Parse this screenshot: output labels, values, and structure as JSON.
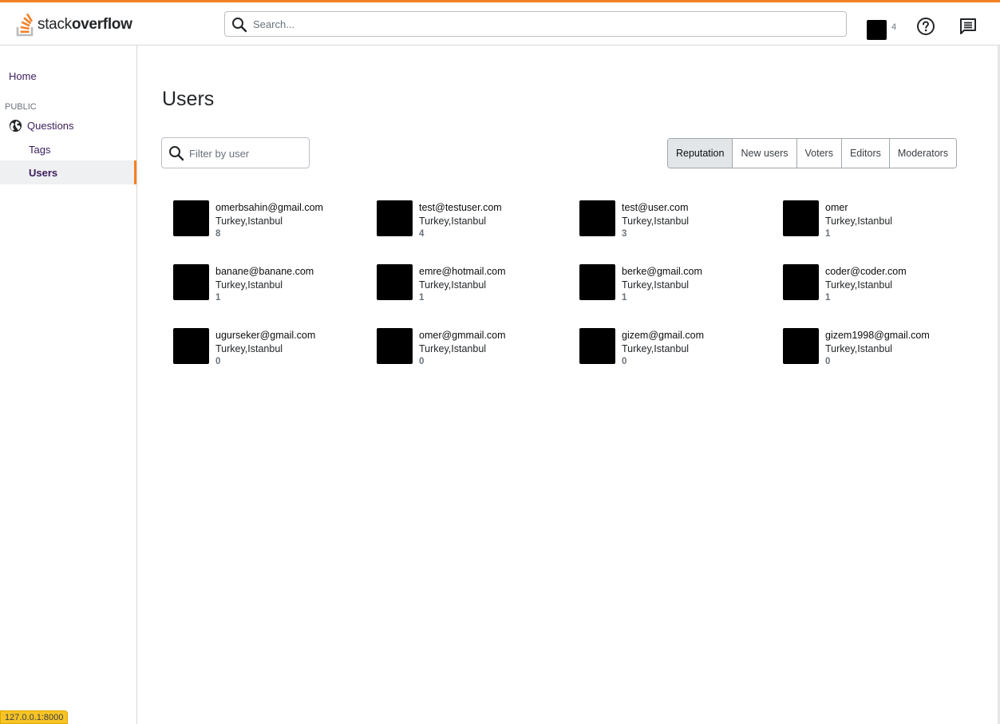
{
  "header": {
    "logo_light": "stack",
    "logo_bold": "overflow",
    "search_placeholder": "Search...",
    "reputation": "4",
    "icons": [
      "search-icon",
      "help-icon",
      "inbox-icon"
    ]
  },
  "sidebar": {
    "home": "Home",
    "section": "PUBLIC",
    "questions": "Questions",
    "tags": "Tags",
    "users": "Users",
    "icons": [
      "globe-icon"
    ]
  },
  "main": {
    "title": "Users",
    "filter_placeholder": "Filter by user",
    "tabs": [
      "Reputation",
      "New users",
      "Voters",
      "Editors",
      "Moderators"
    ],
    "active_tab": "Reputation",
    "users": [
      {
        "name": "omerbsahin@gmail.com",
        "location": "Turkey,Istanbul",
        "reputation": "8"
      },
      {
        "name": "test@testuser.com",
        "location": "Turkey,Istanbul",
        "reputation": "4"
      },
      {
        "name": "test@user.com",
        "location": "Turkey,Istanbul",
        "reputation": "3"
      },
      {
        "name": "omer",
        "location": "Turkey,Istanbul",
        "reputation": "1"
      },
      {
        "name": "banane@banane.com",
        "location": "Turkey,Istanbul",
        "reputation": "1"
      },
      {
        "name": "emre@hotmail.com",
        "location": "Turkey,Istanbul",
        "reputation": "1"
      },
      {
        "name": "berke@gmail.com",
        "location": "Turkey,Istanbul",
        "reputation": "1"
      },
      {
        "name": "coder@coder.com",
        "location": "Turkey,Istanbul",
        "reputation": "1"
      },
      {
        "name": "ugurseker@gmail.com",
        "location": "Turkey,Istanbul",
        "reputation": "0"
      },
      {
        "name": "omer@gmmail.com",
        "location": "Turkey,Istanbul",
        "reputation": "0"
      },
      {
        "name": "gizem@gmail.com",
        "location": "Turkey,Istanbul",
        "reputation": "0"
      },
      {
        "name": "gizem1998@gmail.com",
        "location": "Turkey,Istanbul",
        "reputation": "0"
      }
    ]
  },
  "status_bar": {
    "url": "127.0.0.1:8000"
  },
  "colors": {
    "accent": "#f48024",
    "nav_text": "#3b1d5c",
    "active_tab_bg": "#e3e6e8"
  }
}
